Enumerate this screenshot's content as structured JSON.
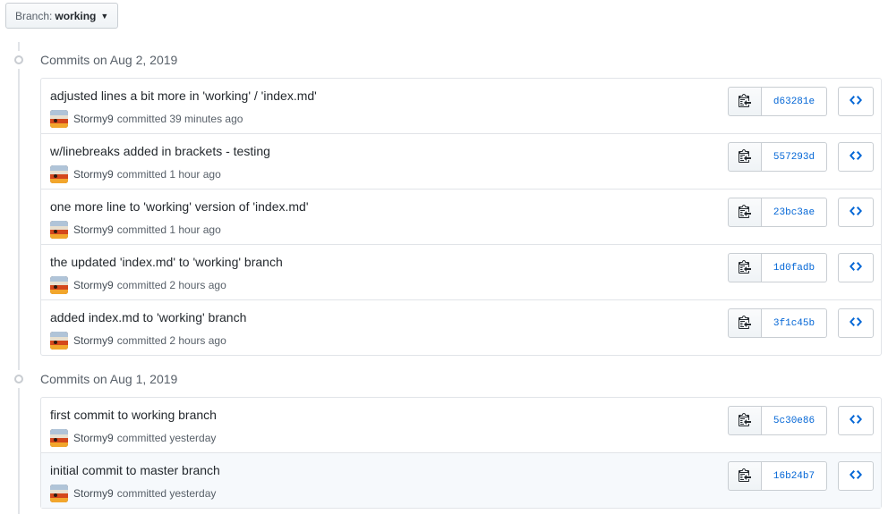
{
  "branch": {
    "label": "Branch:",
    "name": "working"
  },
  "groups": [
    {
      "title": "Commits on Aug 2, 2019",
      "commits": [
        {
          "message": "adjusted lines a bit more in 'working' / 'index.md'",
          "author": "Stormy9",
          "time": "committed 39 minutes ago",
          "sha": "d63281e"
        },
        {
          "message": "w/linebreaks added in brackets - testing",
          "author": "Stormy9",
          "time": "committed 1 hour ago",
          "sha": "557293d"
        },
        {
          "message": "one more line to 'working' version of 'index.md'",
          "author": "Stormy9",
          "time": "committed 1 hour ago",
          "sha": "23bc3ae"
        },
        {
          "message": "the updated 'index.md' to 'working' branch",
          "author": "Stormy9",
          "time": "committed 2 hours ago",
          "sha": "1d0fadb"
        },
        {
          "message": "added index.md to 'working' branch",
          "author": "Stormy9",
          "time": "committed 2 hours ago",
          "sha": "3f1c45b"
        }
      ]
    },
    {
      "title": "Commits on Aug 1, 2019",
      "commits": [
        {
          "message": "first commit to working branch",
          "author": "Stormy9",
          "time": "committed yesterday",
          "sha": "5c30e86"
        },
        {
          "message": "initial commit to master branch",
          "author": "Stormy9",
          "time": "committed yesterday",
          "sha": "16b24b7"
        }
      ]
    }
  ],
  "colors": {
    "link": "#0366d6",
    "muted": "#586069",
    "border": "#e1e4e8"
  },
  "icons": {
    "copy": "clippy-icon",
    "browse": "code-icon",
    "commit": "git-commit-icon",
    "caret": "caret-down-icon"
  }
}
